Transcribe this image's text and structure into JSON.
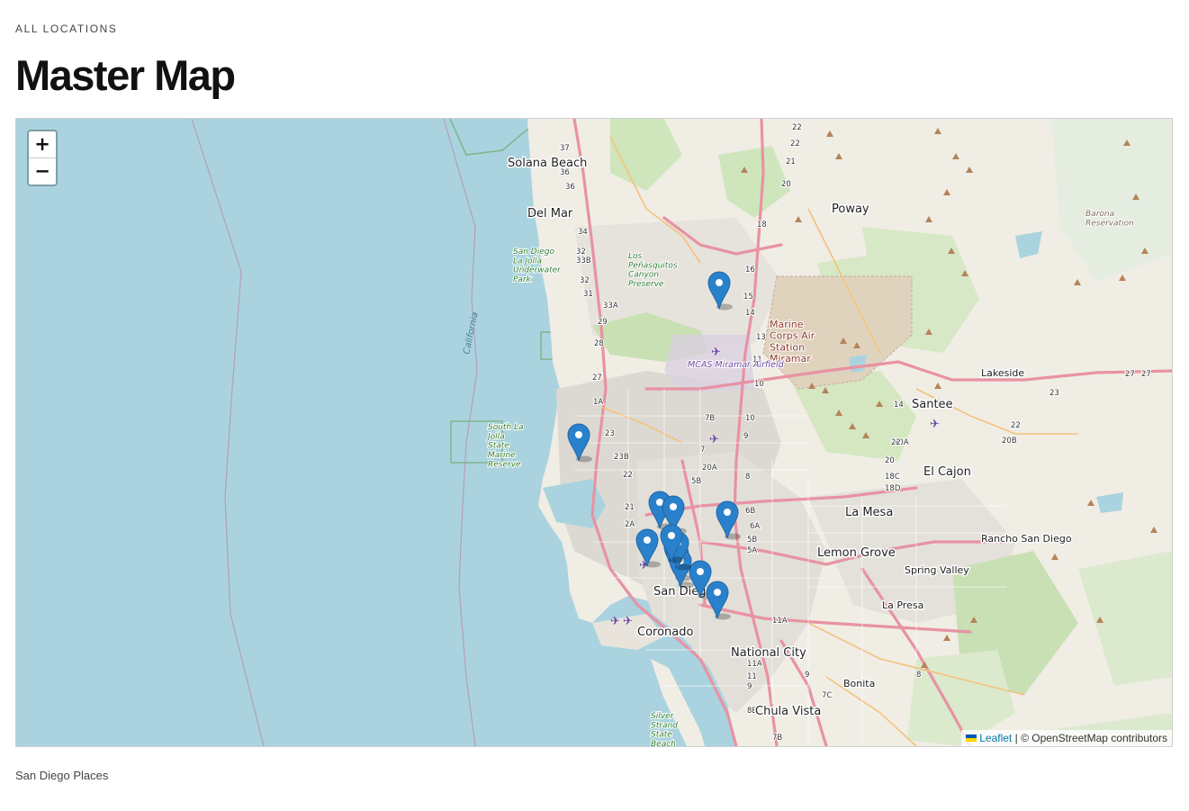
{
  "header": {
    "eyebrow": "ALL LOCATIONS",
    "title": "Master Map"
  },
  "map": {
    "zoom_in_label": "+",
    "zoom_out_label": "−",
    "attribution": {
      "leaflet_label": "Leaflet",
      "separator": "|",
      "osm_text": "© OpenStreetMap contributors"
    },
    "marker_color": "#2a81cb",
    "marker_count": 13,
    "place_labels": [
      "Solana Beach",
      "Del Mar",
      "Poway",
      "Santee",
      "El Cajon",
      "La Mesa",
      "Lemon Grove",
      "Lakeside",
      "Spring Valley",
      "Rancho San Diego",
      "San Diego",
      "Coronado",
      "National City",
      "La Presa",
      "Bonita",
      "Chula Vista"
    ],
    "park_labels": [
      "San Diego La Jolla Underwater Park",
      "Los Peñasquitos Canyon Preserve",
      "South La Jolla State Marine Reserve",
      "Silver Strand State Beach",
      "Barona Reservation"
    ],
    "military_labels": [
      "Marine Corps Air Station Miramar"
    ],
    "airport_labels": [
      "MCAS Miramar Airfield"
    ],
    "water_labels": [
      "California"
    ]
  },
  "caption": "San Diego Places"
}
